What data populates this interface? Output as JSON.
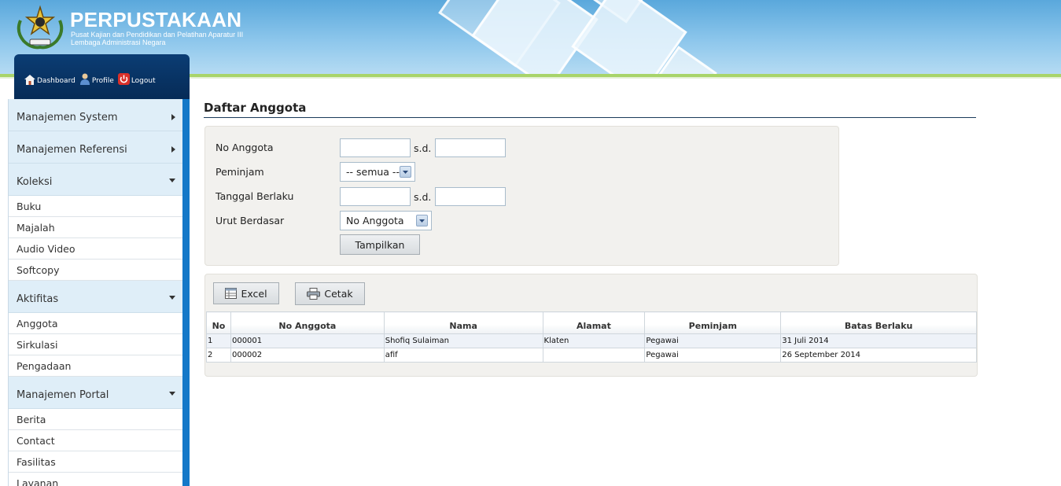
{
  "header": {
    "title": "PERPUSTAKAAN",
    "subtitle_line1": "Pusat Kajian dan Pendidikan dan Pelatihan Aparatur III",
    "subtitle_line2": "Lembaga Administrasi Negara"
  },
  "toplinks": [
    {
      "label": "Dashboard",
      "icon": "home-icon"
    },
    {
      "label": "Profile",
      "icon": "user-icon"
    },
    {
      "label": "Logout",
      "icon": "power-icon"
    }
  ],
  "sidebar": {
    "manajemen_system": "Manajemen System",
    "manajemen_referensi": "Manajemen Referensi",
    "koleksi": {
      "label": "Koleksi",
      "items": [
        "Buku",
        "Majalah",
        "Audio Video",
        "Softcopy"
      ]
    },
    "aktifitas": {
      "label": "Aktifitas",
      "items": [
        "Anggota",
        "Sirkulasi",
        "Pengadaan"
      ]
    },
    "manajemen_portal": {
      "label": "Manajemen Portal",
      "items": [
        "Berita",
        "Contact",
        "Fasilitas",
        "Layanan"
      ]
    }
  },
  "page": {
    "title": "Daftar Anggota"
  },
  "filter": {
    "no_anggota_label": "No Anggota",
    "sd": "s.d.",
    "peminjam_label": "Peminjam",
    "peminjam_value": "-- semua --",
    "tanggal_label": "Tanggal Berlaku",
    "urut_label": "Urut Berdasar",
    "urut_value": "No Anggota",
    "tampilkan": "Tampilkan"
  },
  "actions": {
    "excel": "Excel",
    "cetak": "Cetak"
  },
  "table": {
    "headers": [
      "No",
      "No Anggota",
      "Nama",
      "Alamat",
      "Peminjam",
      "Batas Berlaku"
    ],
    "rows": [
      [
        "1",
        "000001",
        "Shofiq Sulaiman",
        "Klaten",
        "Pegawai",
        "31 Juli 2014"
      ],
      [
        "2",
        "000002",
        "afif",
        "",
        "Pegawai",
        "26 September 2014"
      ]
    ]
  }
}
